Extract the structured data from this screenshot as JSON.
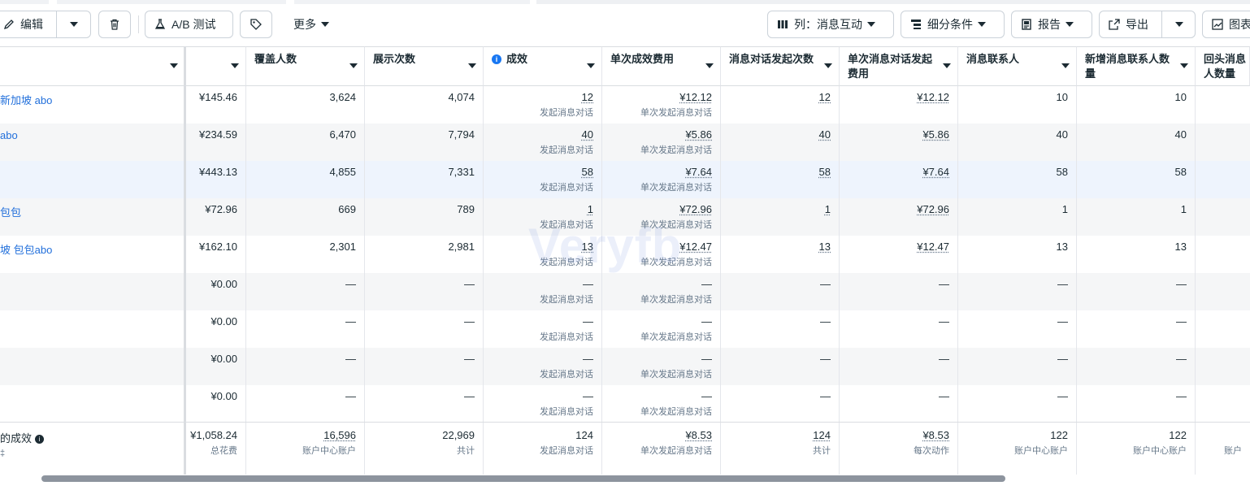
{
  "toolbar": {
    "edit_label": "编辑",
    "ab_test_label": "A/B 测试",
    "more_label": "更多",
    "columns_label": "列：消息互动",
    "breakdown_label": "细分条件",
    "report_label": "报告",
    "export_label": "导出",
    "chart_label": "图表"
  },
  "headers": {
    "spend": "",
    "reach": "覆盖人数",
    "impressions": "展示次数",
    "results": "成效",
    "cost_per_result": "单次成效费用",
    "msg_conversations": "消息对话发起次数",
    "cost_per_conversation": "单次消息对话发起费用",
    "msg_contacts": "消息联系人",
    "new_msg_contacts": "新增消息联系人数量",
    "returning_contacts": "回头消息人数量"
  },
  "rows": [
    {
      "name": "新加坡 abo",
      "spend": "¥145.46",
      "reach": "3,624",
      "impressions": "4,074",
      "results": "12",
      "results_sub": "发起消息对话",
      "cpr": "¥12.12",
      "cpr_sub": "单次发起消息对话",
      "conv": "12",
      "cpc": "¥12.12",
      "contacts": "10",
      "new_contacts": "10"
    },
    {
      "name": "abo",
      "spend": "¥234.59",
      "reach": "6,470",
      "impressions": "7,794",
      "results": "40",
      "results_sub": "发起消息对话",
      "cpr": "¥5.86",
      "cpr_sub": "单次发起消息对话",
      "conv": "40",
      "cpc": "¥5.86",
      "contacts": "40",
      "new_contacts": "40"
    },
    {
      "name": "",
      "spend": "¥443.13",
      "reach": "4,855",
      "impressions": "7,331",
      "results": "58",
      "results_sub": "发起消息对话",
      "cpr": "¥7.64",
      "cpr_sub": "单次发起消息对话",
      "conv": "58",
      "cpc": "¥7.64",
      "contacts": "58",
      "new_contacts": "58"
    },
    {
      "name": "包包",
      "spend": "¥72.96",
      "reach": "669",
      "impressions": "789",
      "results": "1",
      "results_sub": "发起消息对话",
      "cpr": "¥72.96",
      "cpr_sub": "单次发起消息对话",
      "conv": "1",
      "cpc": "¥72.96",
      "contacts": "1",
      "new_contacts": "1"
    },
    {
      "name": "坡 包包abo",
      "spend": "¥162.10",
      "reach": "2,301",
      "impressions": "2,981",
      "results": "13",
      "results_sub": "发起消息对话",
      "cpr": "¥12.47",
      "cpr_sub": "单次发起消息对话",
      "conv": "13",
      "cpc": "¥12.47",
      "contacts": "13",
      "new_contacts": "13"
    },
    {
      "name": "",
      "spend": "¥0.00",
      "reach": "—",
      "impressions": "—",
      "results": "—",
      "results_sub": "发起消息对话",
      "cpr": "—",
      "cpr_sub": "单次发起消息对话",
      "conv": "—",
      "cpc": "—",
      "contacts": "—",
      "new_contacts": "—"
    },
    {
      "name": "",
      "spend": "¥0.00",
      "reach": "—",
      "impressions": "—",
      "results": "—",
      "results_sub": "发起消息对话",
      "cpr": "—",
      "cpr_sub": "单次发起消息对话",
      "conv": "—",
      "cpc": "—",
      "contacts": "—",
      "new_contacts": "—"
    },
    {
      "name": "",
      "spend": "¥0.00",
      "reach": "—",
      "impressions": "—",
      "results": "—",
      "results_sub": "发起消息对话",
      "cpr": "—",
      "cpr_sub": "单次发起消息对话",
      "conv": "—",
      "cpc": "—",
      "contacts": "—",
      "new_contacts": "—"
    },
    {
      "name": "",
      "spend": "¥0.00",
      "reach": "—",
      "impressions": "—",
      "results": "—",
      "results_sub": "发起消息对话",
      "cpr": "—",
      "cpr_sub": "单次发起消息对话",
      "conv": "—",
      "cpc": "—",
      "contacts": "—",
      "new_contacts": "—"
    }
  ],
  "totals": {
    "label": "的成效",
    "label_sub": "‡",
    "spend": "¥1,058.24",
    "spend_sub": "总花费",
    "reach": "16,596",
    "reach_sub": "账户中心账户",
    "impressions": "22,969",
    "impressions_sub": "共计",
    "results": "124",
    "results_sub": "发起消息对话",
    "cpr": "¥8.53",
    "cpr_sub": "单次发起消息对话",
    "conv": "124",
    "conv_sub": "共计",
    "cpc": "¥8.53",
    "cpc_sub": "每次动作",
    "contacts": "122",
    "contacts_sub": "账户中心账户",
    "new_contacts": "122",
    "new_contacts_sub": "账户中心账户",
    "returning_sub": "账户"
  },
  "watermark": "Veryfb",
  "colors": {
    "link": "#216fdb",
    "info": "#1877f2",
    "border": "#cbd2d9",
    "highlight_row": "#eef4fd"
  }
}
